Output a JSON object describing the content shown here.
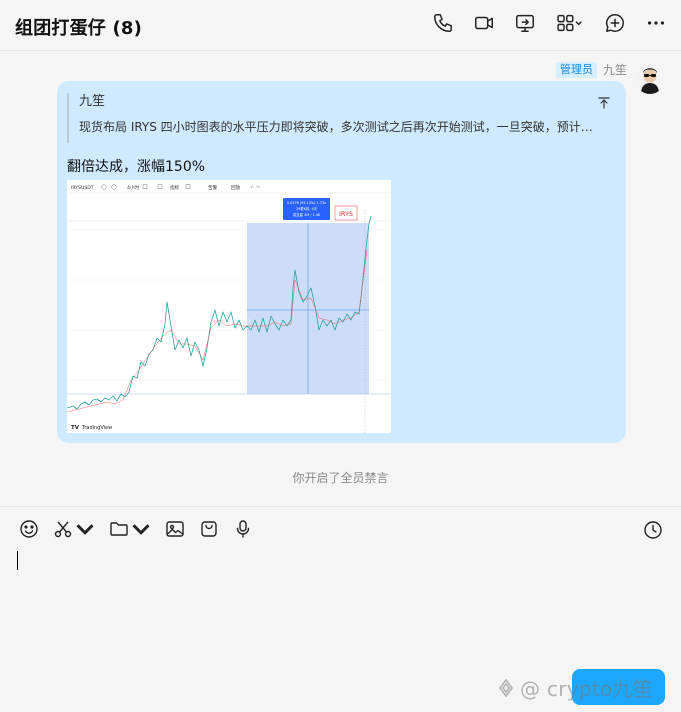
{
  "header": {
    "title": "组团打蛋仔 (8)"
  },
  "message": {
    "sender_badge": "管理员",
    "sender_name": "九笙",
    "quote": {
      "name": "九笙",
      "text": "现货布局 IRYS 四小时图表的水平压力即将突破，多次测试之后再次开始测试，一旦突破，预计出..."
    },
    "text": "翻倍达成，涨幅150%",
    "image": {
      "symbol": "IRYSUSDT",
      "interval": "4小时",
      "toolbar_items": [
        "指标",
        "告警",
        "回放"
      ],
      "annotation_line1": "0.0576 (95.13%) 1.73x",
      "annotation_line2": "29根K线, 4天",
      "annotation_line3": "成交量 3M / 1.4K",
      "tag": "IRYS",
      "brand": "TradingView"
    }
  },
  "system_message": "你开启了全员禁言",
  "input": {
    "value": "",
    "placeholder": ""
  },
  "send_label": "",
  "watermark": "@ crypto九笙",
  "colors": {
    "bubble": "#cfe9ff",
    "accent": "#1ea7ff",
    "selection": "#aec8f5"
  }
}
